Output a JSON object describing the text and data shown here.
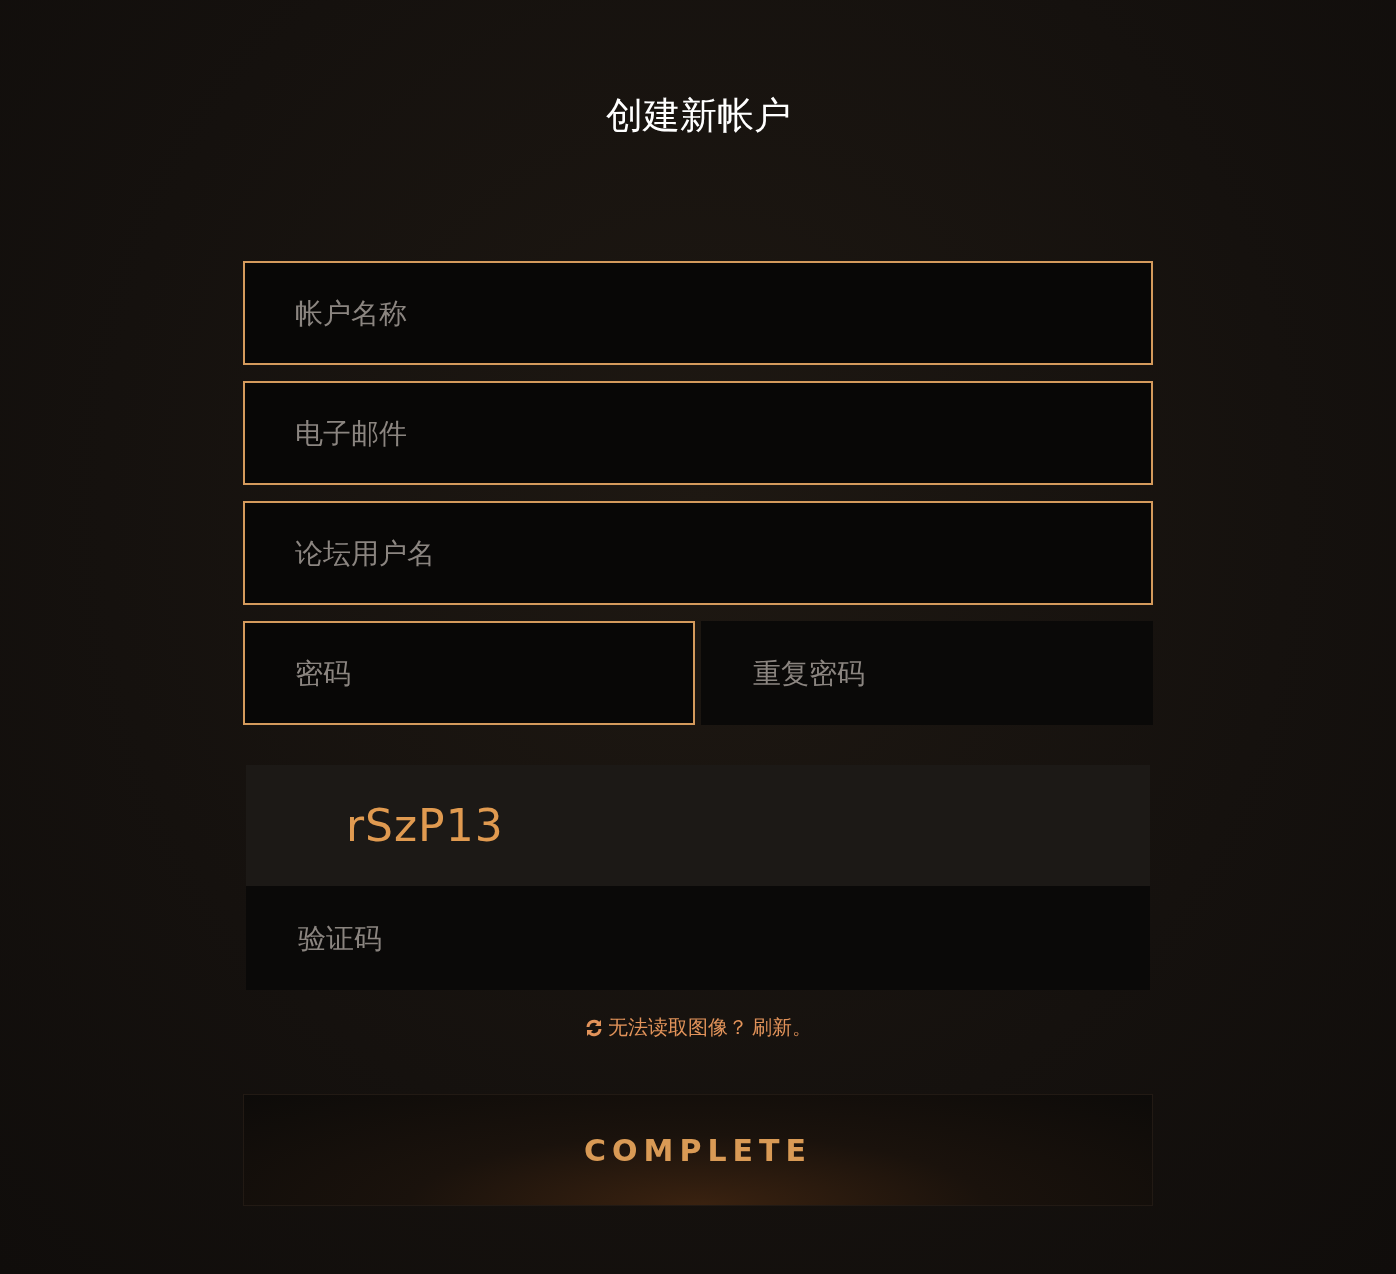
{
  "title": "创建新帐户",
  "fields": [
    {
      "placeholder": "帐户名称",
      "highlighted": true
    },
    {
      "placeholder": "电子邮件",
      "highlighted": true
    },
    {
      "placeholder": "论坛用户名",
      "highlighted": true
    }
  ],
  "password_row": [
    {
      "placeholder": "密码",
      "highlighted": true
    },
    {
      "placeholder": "重复密码",
      "highlighted": false
    }
  ],
  "captcha": {
    "code": "rSzP13",
    "input": {
      "placeholder": "验证码",
      "highlighted": false
    }
  },
  "refresh": {
    "question": "无法读取图像？",
    "link": "刷新。"
  },
  "submit_button": "COMPLETE"
}
